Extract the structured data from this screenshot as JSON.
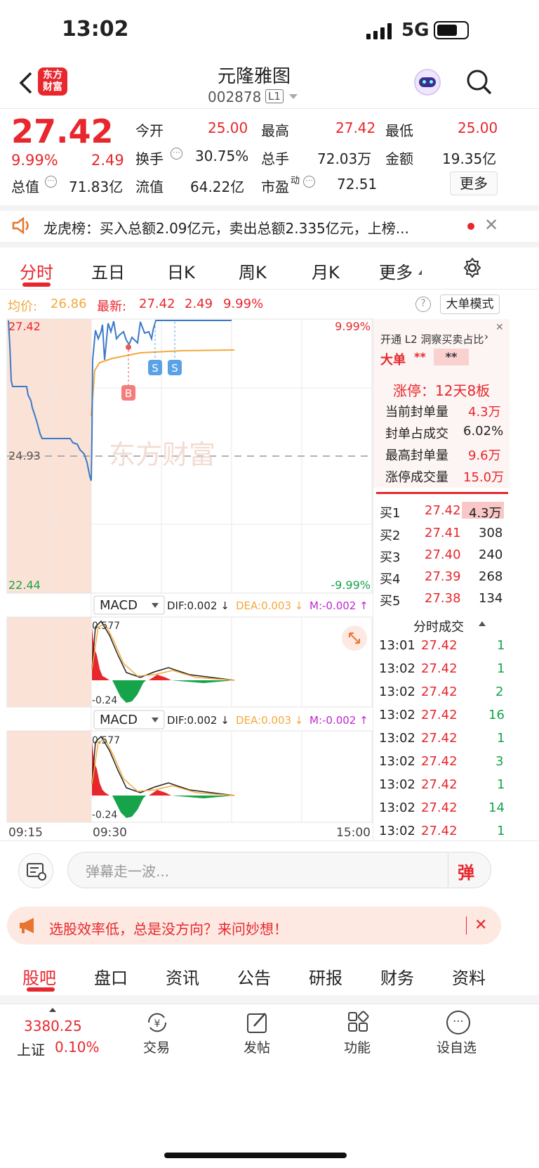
{
  "status": {
    "time": "13:02",
    "net": "5G"
  },
  "header": {
    "logo_line1": "东方",
    "logo_line2": "财富",
    "title": "元隆雅图",
    "code": "002878",
    "level": "L1"
  },
  "quote": {
    "price": "27.42",
    "pct": "9.99%",
    "chg": "2.49",
    "fields": [
      {
        "l": "今开",
        "v": "25.00"
      },
      {
        "l": "最高",
        "v": "27.42"
      },
      {
        "l": "最低",
        "v": "25.00"
      },
      {
        "l": "换手",
        "v": "30.75%"
      },
      {
        "l": "总手",
        "v": "72.03万"
      },
      {
        "l": "金额",
        "v": "19.35亿"
      },
      {
        "l": "总值",
        "v": "71.83亿"
      },
      {
        "l": "流值",
        "v": "64.22亿"
      },
      {
        "l": "市盈",
        "sup": "动",
        "v": "72.51"
      }
    ],
    "more": "更多"
  },
  "notice": {
    "text": "龙虎榜：买入总额2.09亿元，卖出总额2.335亿元，上榜..."
  },
  "chart_tabs": [
    "分时",
    "五日",
    "日K",
    "周K",
    "月K",
    "更多"
  ],
  "avg_bar": {
    "avg_label": "均价:",
    "avg": "26.86",
    "latest_label": "最新:",
    "latest": "27.42",
    "chg": "2.49",
    "pct": "9.99%",
    "big_mode": "大单模式"
  },
  "chart": {
    "top": "27.42",
    "top_pct": "9.99%",
    "mid": "24.93",
    "bottom": "22.44",
    "bottom_pct": "-9.99%",
    "watermark": "东方财富",
    "time_start": "09:15",
    "time_open": "09:30",
    "time_end": "15:00",
    "mark_b": "B",
    "mark_s": "S"
  },
  "chart_data": {
    "type": "line",
    "y_range": [
      22.44,
      27.42
    ],
    "prev_close": 24.93,
    "series": [
      {
        "name": "最新",
        "values": [
          27.42,
          25.1,
          24.6,
          24.93,
          25.3,
          27.0,
          27.2,
          27.42
        ]
      },
      {
        "name": "均价",
        "values": [
          25.8,
          26.3,
          26.6,
          26.8,
          26.86
        ]
      }
    ]
  },
  "macd": {
    "name": "MACD",
    "dif": "DIF:0.002 ↓",
    "dea": "DEA:0.003 ↓",
    "m": "M:-0.002 ↑",
    "hi": "0.577",
    "lo": "-0.24"
  },
  "side": {
    "l2": "开通 L2 洞察买卖占比",
    "big_label": "大单",
    "big_v1": "**",
    "big_v2": "**",
    "limit_title": "涨停：12天8板",
    "rows": [
      {
        "l": "当前封单量",
        "v": "4.3万"
      },
      {
        "l": "封单占成交",
        "v": "6.02%"
      },
      {
        "l": "最高封单量",
        "v": "9.6万"
      },
      {
        "l": "涨停成交量",
        "v": "15.0万"
      }
    ],
    "bids": [
      {
        "l": "买1",
        "p": "27.42",
        "v": "4.3万"
      },
      {
        "l": "买2",
        "p": "27.41",
        "v": "308"
      },
      {
        "l": "买3",
        "p": "27.40",
        "v": "240"
      },
      {
        "l": "买4",
        "p": "27.39",
        "v": "268"
      },
      {
        "l": "买5",
        "p": "27.38",
        "v": "134"
      }
    ],
    "ticks_title": "分时成交",
    "ticks": [
      {
        "t": "13:01",
        "p": "27.42",
        "v": "1"
      },
      {
        "t": "13:02",
        "p": "27.42",
        "v": "1"
      },
      {
        "t": "13:02",
        "p": "27.42",
        "v": "2"
      },
      {
        "t": "13:02",
        "p": "27.42",
        "v": "16"
      },
      {
        "t": "13:02",
        "p": "27.42",
        "v": "1"
      },
      {
        "t": "13:02",
        "p": "27.42",
        "v": "3"
      },
      {
        "t": "13:02",
        "p": "27.42",
        "v": "1"
      },
      {
        "t": "13:02",
        "p": "27.42",
        "v": "14"
      },
      {
        "t": "13:02",
        "p": "27.42",
        "v": "1"
      }
    ]
  },
  "comment": {
    "placeholder": "弹幕走一波...",
    "danmu": "弹"
  },
  "promo": {
    "text": "选股效率低，总是没方向？来问妙想！"
  },
  "bottom_tabs": [
    "股吧",
    "盘口",
    "资讯",
    "公告",
    "研报",
    "财务",
    "资料"
  ],
  "dock": {
    "index_val": "3380.25",
    "index_name": "上证",
    "index_pct": "0.10%",
    "items": [
      "交易",
      "发帖",
      "功能",
      "设自选"
    ]
  }
}
